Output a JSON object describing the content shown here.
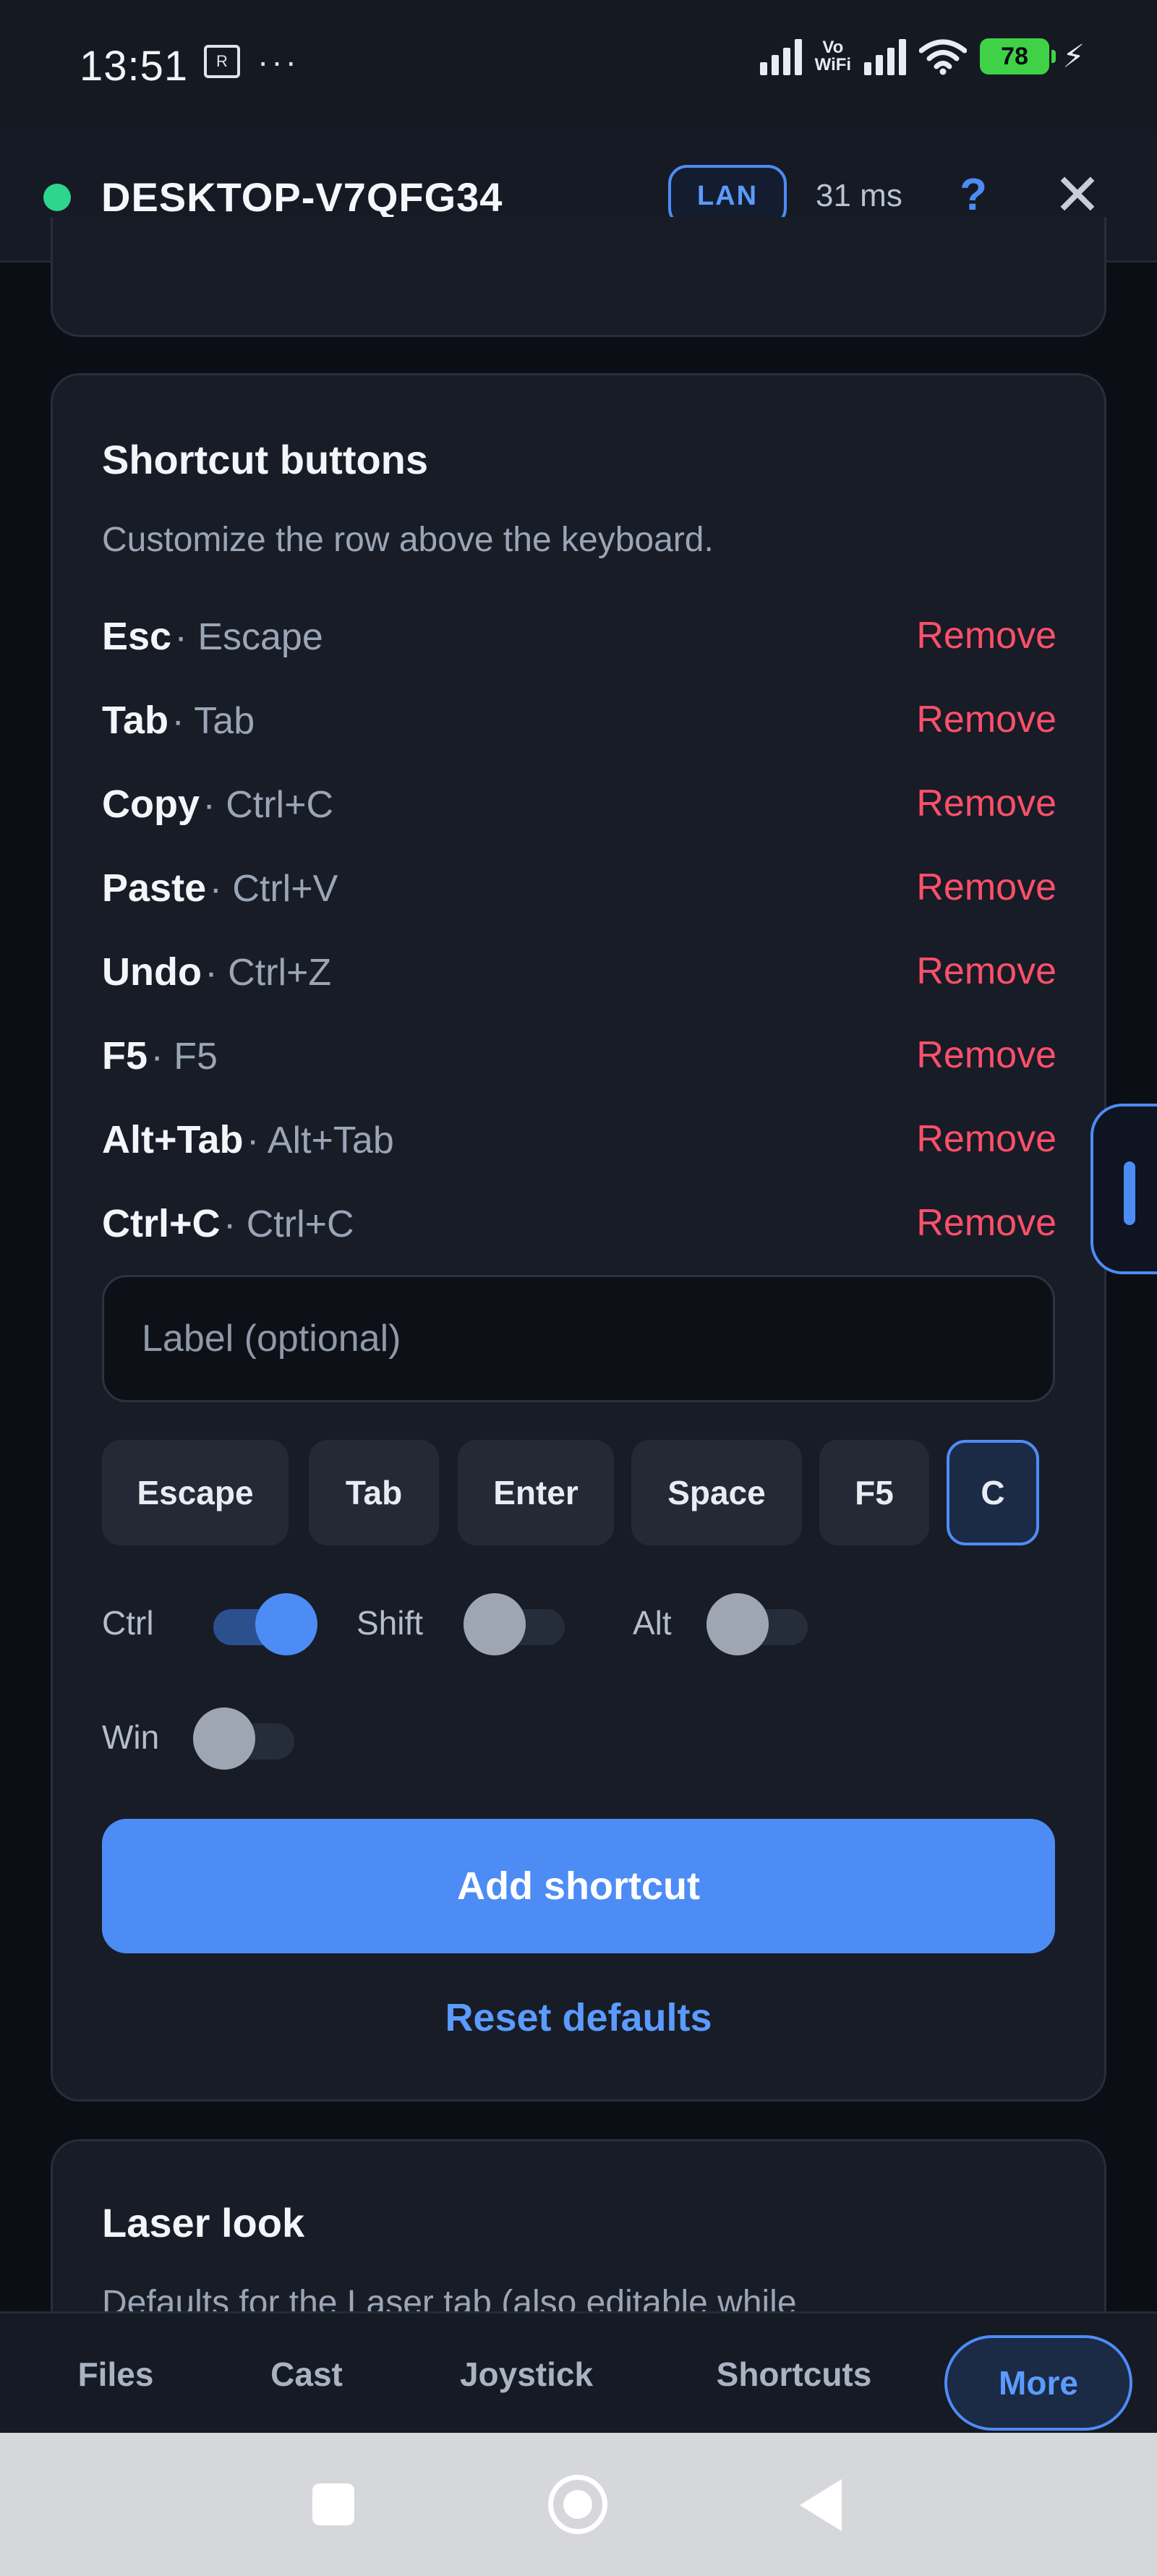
{
  "status_bar": {
    "time": "13:51",
    "sim_icon_text": "R",
    "more": "···",
    "vowifi_top": "Vo",
    "vowifi_bottom": "WiFi",
    "battery": "78",
    "icons": [
      "signal-icon",
      "vowifi-icon",
      "signal-icon",
      "wifi-icon",
      "battery-icon",
      "charging-icon"
    ]
  },
  "header": {
    "device_name": "DESKTOP-V7QFG34",
    "connection_badge": "LAN",
    "latency": "31 ms",
    "help": "?",
    "close": "✕",
    "status_color": "#2ed58c"
  },
  "shortcut_buttons": {
    "title": "Shortcut buttons",
    "subtitle": "Customize the row above the keyboard.",
    "separator": "·",
    "remove_label": "Remove",
    "items": [
      {
        "name": "Esc",
        "combo": "Escape"
      },
      {
        "name": "Tab",
        "combo": "Tab"
      },
      {
        "name": "Copy",
        "combo": "Ctrl+C"
      },
      {
        "name": "Paste",
        "combo": "Ctrl+V"
      },
      {
        "name": "Undo",
        "combo": "Ctrl+Z"
      },
      {
        "name": "F5",
        "combo": "F5"
      },
      {
        "name": "Alt+Tab",
        "combo": "Alt+Tab"
      },
      {
        "name": "Ctrl+C",
        "combo": "Ctrl+C"
      }
    ],
    "label_input": {
      "value": "",
      "placeholder": "Label (optional)"
    },
    "keys": [
      {
        "label": "Escape",
        "selected": false
      },
      {
        "label": "Tab",
        "selected": false
      },
      {
        "label": "Enter",
        "selected": false
      },
      {
        "label": "Space",
        "selected": false
      },
      {
        "label": "F5",
        "selected": false
      },
      {
        "label": "C",
        "selected": true
      }
    ],
    "modifiers": [
      {
        "label": "Ctrl",
        "on": true
      },
      {
        "label": "Shift",
        "on": false
      },
      {
        "label": "Alt",
        "on": false
      },
      {
        "label": "Win",
        "on": false
      }
    ],
    "add_button": "Add shortcut",
    "reset_link": "Reset defaults"
  },
  "laser_look": {
    "title": "Laser look",
    "subtitle": "Defaults for the Laser tab (also editable while"
  },
  "bottom_nav": {
    "items": [
      "Files",
      "Cast",
      "Joystick",
      "Shortcuts",
      "More"
    ],
    "active": "More"
  },
  "colors": {
    "accent": "#4d8cf5",
    "danger": "#ff4f6a",
    "online": "#2ed58c",
    "background": "#0b0e14",
    "card": "#171c27"
  }
}
